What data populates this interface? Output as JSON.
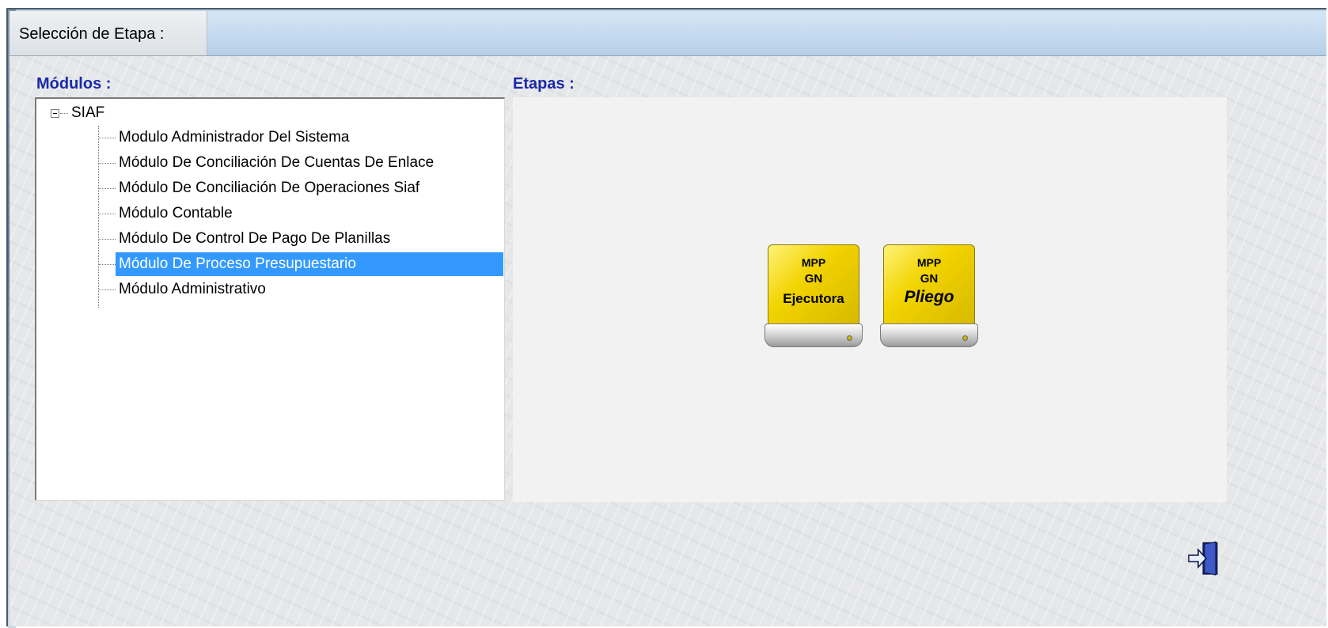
{
  "window": {
    "title": "Selección de Etapa :"
  },
  "modules": {
    "label": "Módulos :",
    "root": "SIAF",
    "items": [
      {
        "label": "Modulo Administrador Del Sistema",
        "selected": false
      },
      {
        "label": "Módulo De Conciliación De Cuentas De Enlace",
        "selected": false
      },
      {
        "label": "Módulo De Conciliación De Operaciones Siaf",
        "selected": false
      },
      {
        "label": "Módulo Contable",
        "selected": false
      },
      {
        "label": "Módulo De Control De Pago De Planillas",
        "selected": false
      },
      {
        "label": "Módulo De Proceso Presupuestario",
        "selected": true
      },
      {
        "label": "Módulo Administrativo",
        "selected": false
      }
    ]
  },
  "stages": {
    "label": "Etapas :",
    "buttons": [
      {
        "line1": "MPP",
        "line2": "GN",
        "line3": "Ejecutora"
      },
      {
        "line1": "MPP",
        "line2": "GN",
        "line3": "Pliego"
      }
    ]
  },
  "icons": {
    "exit": "exit-door-icon",
    "expander": "collapse-minus-icon"
  },
  "colors": {
    "selection": "#3399ff",
    "section_label": "#1a2aa8",
    "stage_yellow": "#f2d400"
  }
}
